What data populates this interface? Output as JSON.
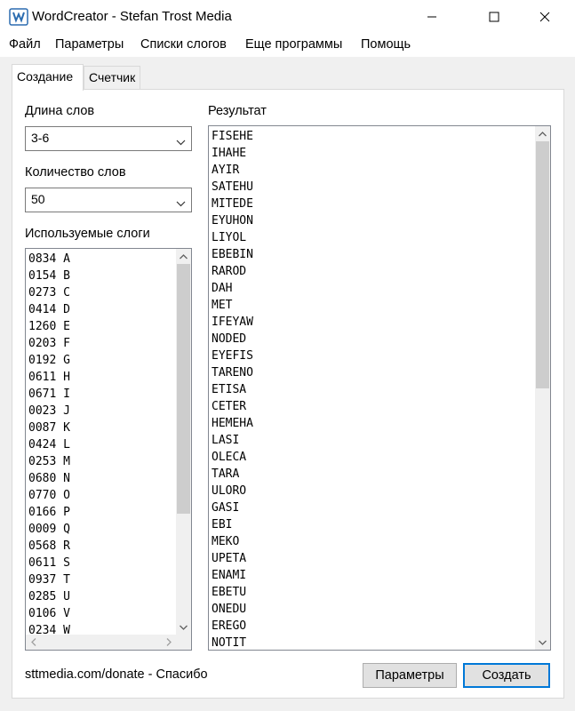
{
  "window": {
    "title": "WordCreator - Stefan Trost Media"
  },
  "menu": [
    "Файл",
    "Параметры",
    "Списки слогов",
    "Еще программы",
    "Помощь"
  ],
  "tabs": [
    "Создание",
    "Счетчик"
  ],
  "fields": {
    "word_length_label": "Длина слов",
    "word_length_value": "3-6",
    "word_count_label": "Количество слов",
    "word_count_value": "50",
    "syllables_label": "Используемые слоги",
    "result_label": "Результат"
  },
  "syllables": [
    {
      "count": "0834",
      "syl": "A"
    },
    {
      "count": "0154",
      "syl": "B"
    },
    {
      "count": "0273",
      "syl": "C"
    },
    {
      "count": "0414",
      "syl": "D"
    },
    {
      "count": "1260",
      "syl": "E"
    },
    {
      "count": "0203",
      "syl": "F"
    },
    {
      "count": "0192",
      "syl": "G"
    },
    {
      "count": "0611",
      "syl": "H"
    },
    {
      "count": "0671",
      "syl": "I"
    },
    {
      "count": "0023",
      "syl": "J"
    },
    {
      "count": "0087",
      "syl": "K"
    },
    {
      "count": "0424",
      "syl": "L"
    },
    {
      "count": "0253",
      "syl": "M"
    },
    {
      "count": "0680",
      "syl": "N"
    },
    {
      "count": "0770",
      "syl": "O"
    },
    {
      "count": "0166",
      "syl": "P"
    },
    {
      "count": "0009",
      "syl": "Q"
    },
    {
      "count": "0568",
      "syl": "R"
    },
    {
      "count": "0611",
      "syl": "S"
    },
    {
      "count": "0937",
      "syl": "T"
    },
    {
      "count": "0285",
      "syl": "U"
    },
    {
      "count": "0106",
      "syl": "V"
    },
    {
      "count": "0234",
      "syl": "W"
    }
  ],
  "results": [
    "FISEHE",
    "IHAHE",
    "AYIR",
    "SATEHU",
    "MITEDE",
    "EYUHON",
    "LIYOL",
    "EBEBIN",
    "RAROD",
    "DAH",
    "MET",
    "IFEYAW",
    "NODED",
    "EYEFIS",
    "TARENO",
    "ETISA",
    "CETER",
    "HEMEHA",
    "LASI",
    "OLECA",
    "TARA",
    "ULORO",
    "GASI",
    "EBI",
    "MEKO",
    "UPETA",
    "ENAMI",
    "EBETU",
    "ONEDU",
    "EREGO",
    "NOTIT"
  ],
  "footer": {
    "donate_text": "sttmedia.com/donate - Спасибо",
    "settings_button": "Параметры",
    "create_button": "Создать"
  },
  "scroll": {
    "syllables_thumb_fraction": 0.41,
    "results_thumb_fraction": 0.5
  },
  "colors": {
    "accent": "#0078d7",
    "client_bg": "#f0f0f0",
    "scroll_thumb": "#cdcdcd"
  }
}
